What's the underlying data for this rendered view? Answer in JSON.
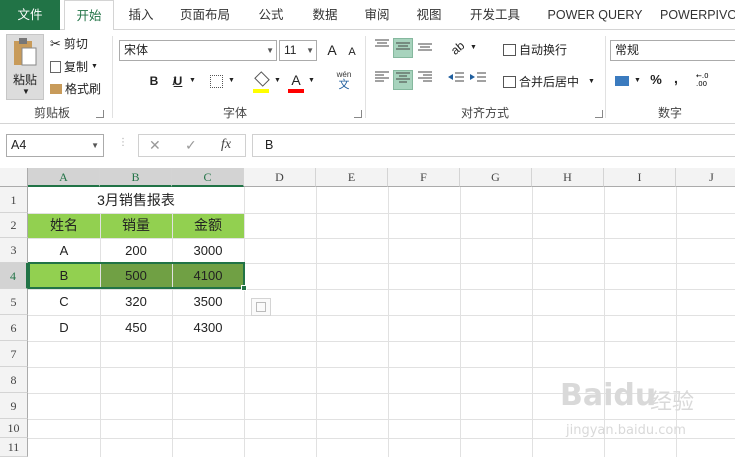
{
  "tabs": [
    {
      "label": "文件"
    },
    {
      "label": "开始"
    },
    {
      "label": "插入"
    },
    {
      "label": "页面布局"
    },
    {
      "label": "公式"
    },
    {
      "label": "数据"
    },
    {
      "label": "审阅"
    },
    {
      "label": "视图"
    },
    {
      "label": "开发工具"
    },
    {
      "label": "POWER QUERY"
    },
    {
      "label": "POWERPIVO"
    }
  ],
  "active_tab": "开始",
  "clipboard": {
    "paste": "粘贴",
    "cut": "剪切",
    "copy": "复制",
    "format_painter": "格式刷",
    "group": "剪贴板"
  },
  "font": {
    "name": "宋体",
    "size": "11",
    "bold": "B",
    "italic": "I",
    "underline": "U",
    "grow": "A",
    "shrink": "A",
    "color_letter": "A",
    "wen": "wén",
    "wen_char": "文",
    "group": "字体",
    "fill_color": "#ffff00",
    "font_color": "#ff0000"
  },
  "align": {
    "wrap": "自动换行",
    "merge": "合并后居中",
    "group": "对齐方式"
  },
  "number": {
    "format": "常规",
    "percent": "%",
    "comma": ",",
    "group": "数字"
  },
  "namebox": "A4",
  "formula": "B",
  "fx": "fx",
  "columns": [
    "A",
    "B",
    "C",
    "D",
    "E",
    "F",
    "G",
    "H",
    "I",
    "J"
  ],
  "rows": [
    "1",
    "2",
    "3",
    "4",
    "5",
    "6",
    "7",
    "8",
    "9",
    "10",
    "11"
  ],
  "sheet": {
    "title": "3月销售报表",
    "header": [
      "姓名",
      "销量",
      "金额"
    ],
    "data": [
      [
        "A",
        "200",
        "3000"
      ],
      [
        "B",
        "500",
        "4100"
      ],
      [
        "C",
        "320",
        "3500"
      ],
      [
        "D",
        "450",
        "4300"
      ]
    ]
  },
  "colors": {
    "accent": "#217346",
    "header_fill": "#92d050",
    "row4_a": "#92d050",
    "row4_bc": "#70a044"
  },
  "watermark": {
    "brand": "Baidu",
    "cn": "经验",
    "url": "jingyan.baidu.com"
  }
}
